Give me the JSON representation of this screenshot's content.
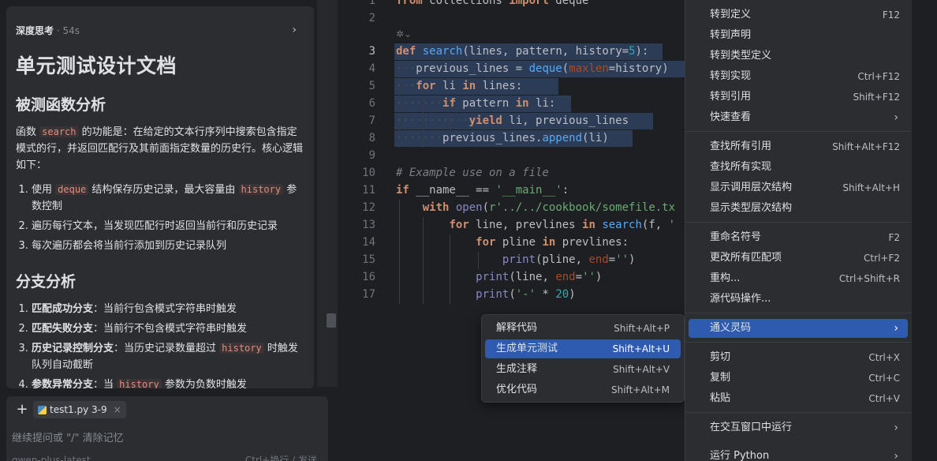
{
  "ai": {
    "think_label": "深度思考",
    "think_time": " · 54s",
    "doc_title": "单元测试设计文档",
    "sec1_title": "被测函数分析",
    "para_pre": "函数 ",
    "para_code": "search",
    "para_post": " 的功能是：在给定的文本行序列中搜索包含指定模式的行，并返回匹配行及其前面指定数量的历史行。核心逻辑如下：",
    "list1": [
      {
        "pre": "使用 ",
        "code1": "deque",
        "mid": " 结构保存历史记录，最大容量由 ",
        "code2": "history",
        "post": " 参数控制"
      },
      {
        "text": "遍历每行文本，当发现匹配行时返回当前行和历史记录"
      },
      {
        "text": "每次遍历都会将当前行添加到历史记录队列"
      }
    ],
    "sec2_title": "分支分析",
    "list2": [
      {
        "bold": "匹配成功分支",
        "text": "：当前行包含模式字符串时触发"
      },
      {
        "bold": "匹配失败分支",
        "text": "：当前行不包含模式字符串时触发"
      },
      {
        "bold": "历史记录控制分支",
        "text": "：当历史记录数量超过 ",
        "code": "history",
        "post": " 时触发队列自动截断"
      },
      {
        "bold": "参数异常分支",
        "text": "：当 ",
        "code": "history",
        "post": " 参数为负数时触发"
      }
    ],
    "file_chip": "test1.py 3-9",
    "prompt_placeholder": "继续提问或 \"/\" 清除记忆",
    "model_hint": "qwen-plus-latest",
    "send_hint": "Ctrl+换行 / 发送"
  },
  "editor": {
    "line_numbers": [
      "1",
      "2",
      "3",
      "4",
      "5",
      "6",
      "7",
      "8",
      "9",
      "10",
      "11",
      "12",
      "13",
      "14",
      "15",
      "16",
      "17"
    ],
    "comment": "# Example use on a file",
    "path": "'../../cookbook/somefile.tx"
  },
  "submenu": {
    "items": [
      {
        "label": "解释代码",
        "shortcut": "Shift+Alt+P"
      },
      {
        "label": "生成单元测试",
        "shortcut": "Shift+Alt+U"
      },
      {
        "label": "生成注释",
        "shortcut": "Shift+Alt+V"
      },
      {
        "label": "优化代码",
        "shortcut": "Shift+Alt+M"
      }
    ]
  },
  "context_menu": {
    "items": [
      {
        "label": "转到定义",
        "shortcut": "F12"
      },
      {
        "label": "转到声明",
        "shortcut": ""
      },
      {
        "label": "转到类型定义",
        "shortcut": ""
      },
      {
        "label": "转到实现",
        "shortcut": "Ctrl+F12"
      },
      {
        "label": "转到引用",
        "shortcut": "Shift+F12"
      },
      {
        "label": "快速查看",
        "shortcut": ""
      },
      {
        "label": "查找所有引用",
        "shortcut": "Shift+Alt+F12"
      },
      {
        "label": "查找所有实现",
        "shortcut": ""
      },
      {
        "label": "显示调用层次结构",
        "shortcut": "Shift+Alt+H"
      },
      {
        "label": "显示类型层次结构",
        "shortcut": ""
      },
      {
        "label": "重命名符号",
        "shortcut": "F2"
      },
      {
        "label": "更改所有匹配项",
        "shortcut": "Ctrl+F2"
      },
      {
        "label": "重构...",
        "shortcut": "Ctrl+Shift+R"
      },
      {
        "label": "源代码操作...",
        "shortcut": ""
      },
      {
        "label": "通义灵码",
        "shortcut": ""
      },
      {
        "label": "剪切",
        "shortcut": "Ctrl+X"
      },
      {
        "label": "复制",
        "shortcut": "Ctrl+C"
      },
      {
        "label": "粘贴",
        "shortcut": "Ctrl+V"
      },
      {
        "label": "在交互窗口中运行",
        "shortcut": ""
      },
      {
        "label": "运行 Python",
        "shortcut": ""
      }
    ]
  }
}
